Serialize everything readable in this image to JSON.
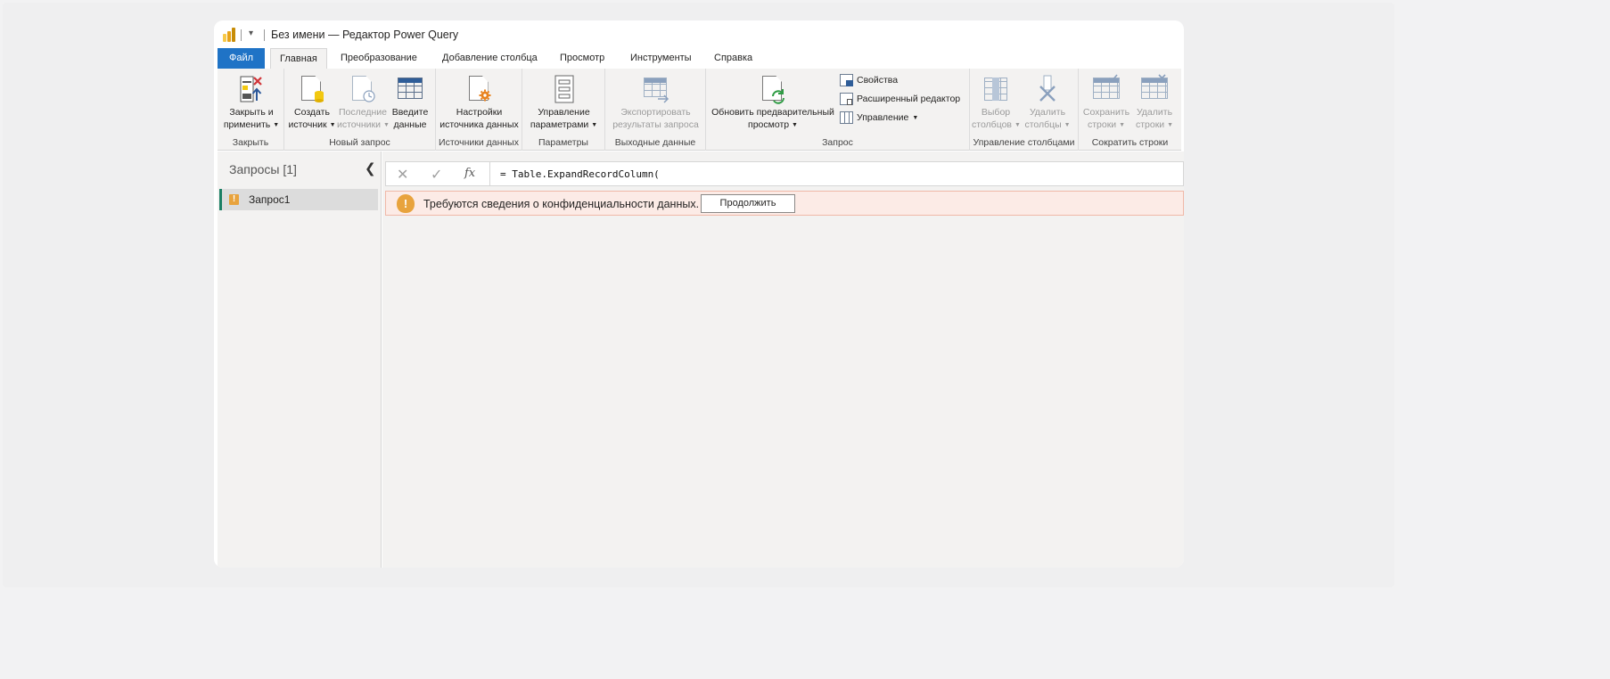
{
  "window": {
    "title": "Без имени — Редактор Power Query",
    "qat_dropdown": "▾"
  },
  "tabs": [
    {
      "label": "Файл"
    },
    {
      "label": "Главная"
    },
    {
      "label": "Преобразование"
    },
    {
      "label": "Добавление столбца"
    },
    {
      "label": "Просмотр"
    },
    {
      "label": "Инструменты"
    },
    {
      "label": "Справка"
    }
  ],
  "ribbon": {
    "close": {
      "group": "Закрыть",
      "close_apply": {
        "line1": "Закрыть и",
        "line2": "применить"
      }
    },
    "new_query": {
      "group": "Новый запрос",
      "new_source": {
        "line1": "Создать",
        "line2": "источник"
      },
      "recent_sources": {
        "line1": "Последние",
        "line2": "источники"
      },
      "enter_data": {
        "line1": "Введите",
        "line2": "данные"
      }
    },
    "data_sources": {
      "group": "Источники данных",
      "settings": {
        "line1": "Настройки",
        "line2": "источника данных"
      }
    },
    "parameters": {
      "group": "Параметры",
      "manage": {
        "line1": "Управление",
        "line2": "параметрами"
      }
    },
    "output": {
      "group": "Выходные данные",
      "export": {
        "line1": "Экспортировать",
        "line2": "результаты запроса"
      }
    },
    "query": {
      "group": "Запрос",
      "refresh": {
        "line1": "Обновить предварительный",
        "line2": "просмотр"
      },
      "properties": "Свойства",
      "advanced_editor": "Расширенный редактор",
      "manage": "Управление"
    },
    "manage_columns": {
      "group": "Управление столбцами",
      "choose": {
        "line1": "Выбор",
        "line2": "столбцов"
      },
      "remove": {
        "line1": "Удалить",
        "line2": "столбцы"
      }
    },
    "reduce_rows": {
      "group": "Сократить строки",
      "keep": {
        "line1": "Сохранить",
        "line2": "строки"
      },
      "remove": {
        "line1": "Удалить",
        "line2": "строки"
      }
    }
  },
  "queries": {
    "title": "Запросы [1]",
    "items": [
      {
        "label": "Запрос1",
        "warning": "!"
      }
    ]
  },
  "formula_bar": {
    "cancel": "✕",
    "commit": "✓",
    "fx": "fx",
    "formula": "= Table.ExpandRecordColumn("
  },
  "warning": {
    "icon": "!",
    "message": "Требуются сведения о конфиденциальности данных.",
    "button": "Продолжить"
  },
  "colors": {
    "file_tab": "#1f73c6",
    "warning_bg": "#fcebe6",
    "warning_icon": "#e8a33d",
    "query_accent": "#1a7f64"
  }
}
